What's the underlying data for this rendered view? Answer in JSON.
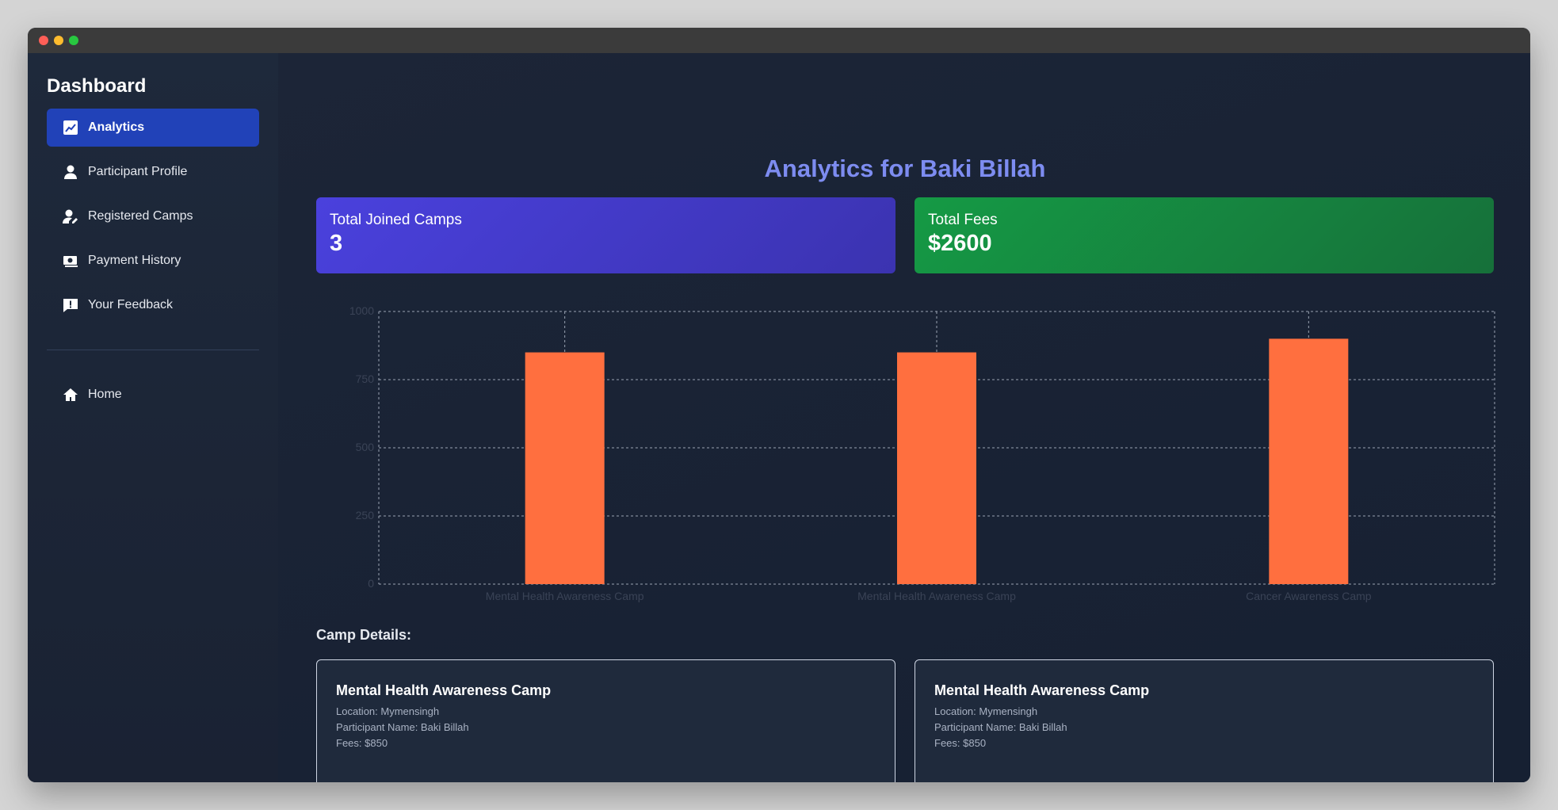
{
  "sidebar": {
    "title": "Dashboard",
    "items": [
      {
        "label": "Analytics",
        "icon": "chart-icon",
        "active": true
      },
      {
        "label": "Participant Profile",
        "icon": "user-icon",
        "active": false
      },
      {
        "label": "Registered Camps",
        "icon": "user-edit-icon",
        "active": false
      },
      {
        "label": "Payment History",
        "icon": "money-icon",
        "active": false
      },
      {
        "label": "Your Feedback",
        "icon": "feedback-icon",
        "active": false
      }
    ],
    "home": {
      "label": "Home",
      "icon": "home-icon"
    }
  },
  "main": {
    "title": "Analytics for Baki Billah",
    "stats": [
      {
        "label": "Total Joined Camps",
        "value": "3"
      },
      {
        "label": "Total Fees",
        "value": "$2600"
      }
    ],
    "section_title": "Camp Details:",
    "camps": [
      {
        "name": "Mental Health Awareness Camp",
        "location": "Location: Mymensingh",
        "participant": "Participant Name: Baki Billah",
        "fees": "Fees: $850"
      },
      {
        "name": "Mental Health Awareness Camp",
        "location": "Location: Mymensingh",
        "participant": "Participant Name: Baki Billah",
        "fees": "Fees: $850"
      }
    ]
  },
  "colors": {
    "accent": "#2142b8",
    "title": "#7d8cf0",
    "bar": "#ff6f3f",
    "stat_purple": "#4a41dd",
    "stat_green": "#159a45"
  },
  "chart_data": {
    "type": "bar",
    "categories": [
      "Mental Health Awareness Camp",
      "Mental Health Awareness Camp",
      "Cancer Awareness Camp"
    ],
    "values": [
      850,
      850,
      900
    ],
    "ylim": [
      0,
      1000
    ],
    "yticks": [
      0,
      250,
      500,
      750,
      1000
    ],
    "grid": true,
    "legend": false
  }
}
